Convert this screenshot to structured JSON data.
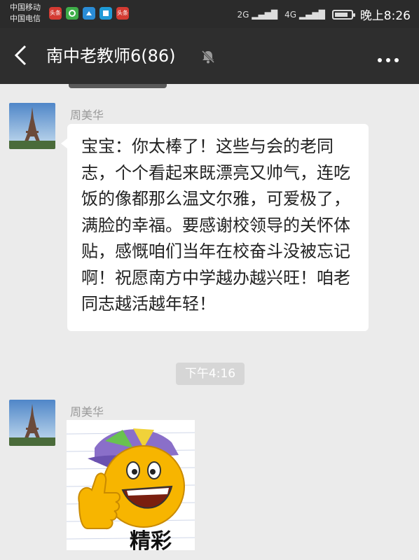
{
  "status_bar": {
    "carrier_1": "中国移动",
    "carrier_2": "中国电信",
    "app_icons": [
      {
        "name": "toutiao-app-icon",
        "label": "头条",
        "color": "#d43b32"
      },
      {
        "name": "green-app-icon",
        "label": "",
        "color": "#3fae49"
      },
      {
        "name": "blue-app-icon",
        "label": "",
        "color": "#2a8cd6"
      },
      {
        "name": "book-app-icon",
        "label": "",
        "color": "#1f9bd7"
      },
      {
        "name": "toutiao-app-icon-2",
        "label": "头条",
        "color": "#d43b32"
      }
    ],
    "network_1": "2G",
    "network_2": "4G",
    "time": "晚上8:26"
  },
  "header": {
    "back_icon": "back-arrow-icon",
    "title": "南中老教师6(86)",
    "mute_icon": "bell-muted-icon",
    "more_icon": "more-dots-icon"
  },
  "messages": [
    {
      "sender": "周美华",
      "avatar_icon": "eiffel-tower-avatar",
      "text": "宝宝：你太棒了！这些与会的老同志，个个看起来既漂亮又帅气，连吃饭的像都那么温文尔雅，可爱极了，满脸的幸福。要感谢校领导的关怀体贴，感慨咱们当年在校奋斗没被忘记啊！祝愿南方中学越办越兴旺！咱老同志越活越年轻！"
    },
    {
      "time_divider": "下午4:16"
    },
    {
      "sender": "周美华",
      "avatar_icon": "eiffel-tower-avatar",
      "sticker_icon": "thumbs-up-smiley-sticker",
      "sticker_text": "精彩"
    }
  ],
  "colors": {
    "chat_background": "#ebebeb",
    "title_bar": "#2e2e2e",
    "bubble": "#ffffff"
  }
}
